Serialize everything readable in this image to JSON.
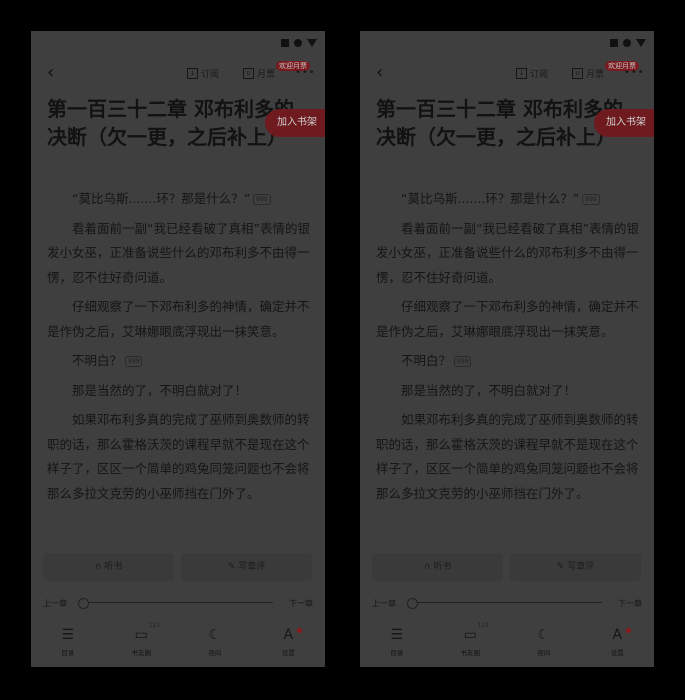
{
  "topbar": {
    "subscribe_label": "订阅",
    "monthly_label": "月票",
    "badge_label": "欢迎月票"
  },
  "chapter": {
    "title": "第一百三十二章 邓布利多的决断（欠一更，之后补上）"
  },
  "shelf_button_label": "加入书架",
  "paragraphs": [
    "“莫比乌斯.......环？那是什么？”",
    "看着面前一副“我已经看破了真相”表情的银发小女巫，正准备说些什么的邓布利多不由得一愣，忍不住好奇问道。",
    "仔细观察了一下邓布利多的神情，确定并不是作伪之后，艾琳娜眼底浮现出一抹笑意。",
    "不明白？",
    "那是当然的了，不明白就对了！",
    "如果邓布利多真的完成了巫师到奥数师的转职的话，那么霍格沃茨的课程早就不是现在这个样子了，区区一个简单的鸡兔同笼问题也不会将那么多拉文克劳的小巫师挡在门外了。"
  ],
  "comment_bubble": "999",
  "actions": {
    "listen_label": "听书",
    "review_label": "写章评"
  },
  "progress": {
    "prev_label": "上一章",
    "next_label": "下一章",
    "position": 0
  },
  "nav": {
    "catalog_label": "目录",
    "circle_label": "书友圈",
    "circle_count": "123",
    "night_label": "夜间",
    "settings_label": "设置"
  },
  "colors": {
    "overlay_bg": "#3f3f3f",
    "accent": "#6e1a1e"
  }
}
